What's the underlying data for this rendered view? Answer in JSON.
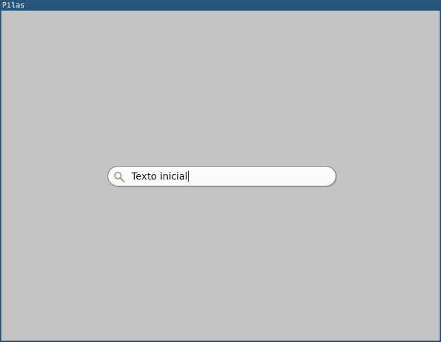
{
  "window": {
    "title": "Pilas"
  },
  "search": {
    "value": "Texto inicial",
    "icon": "search-icon"
  },
  "colors": {
    "titlebar": "#27557c",
    "background": "#c3c3c3",
    "search_icon": "#b09f8b"
  }
}
